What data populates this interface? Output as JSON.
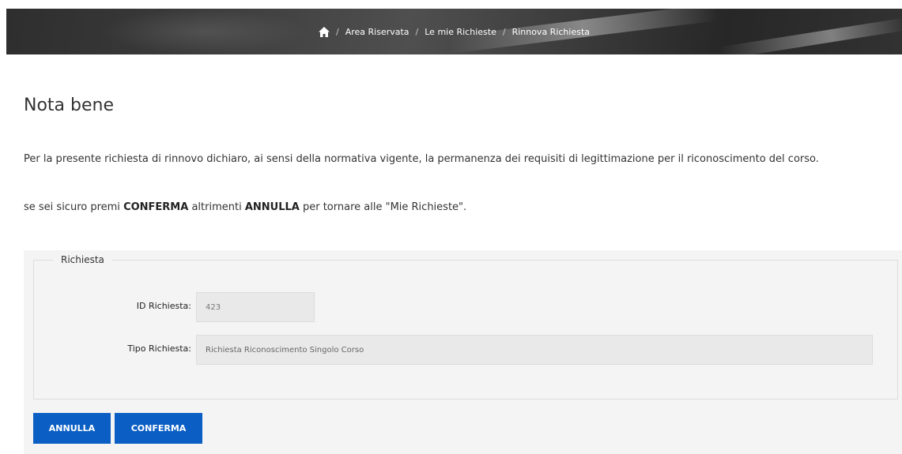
{
  "breadcrumb": {
    "home_icon": "home-icon",
    "separator": "/",
    "items": [
      "Area Riservata",
      "Le mie Richieste",
      "Rinnova Richiesta"
    ]
  },
  "page": {
    "title": "Nota bene",
    "notice_text": "Per la presente richiesta di rinnovo dichiaro, ai sensi della normativa vigente, la permanenza dei requisiti di legittimazione per il riconoscimento del corso.",
    "confirm_prefix": "se sei sicuro premi ",
    "confirm_keyword": "CONFERMA",
    "confirm_middle": " altrimenti ",
    "cancel_keyword": "ANNULLA",
    "confirm_suffix": " per tornare alle \"Mie Richieste\"."
  },
  "form": {
    "legend": "Richiesta",
    "id_label": "ID Richiesta:",
    "id_value": "423",
    "tipo_label": "Tipo Richiesta:",
    "tipo_value": "Richiesta Riconoscimento Singolo Corso"
  },
  "actions": {
    "cancel_label": "ANNULLA",
    "confirm_label": "CONFERMA"
  },
  "colors": {
    "primary_button": "#0b5fc4",
    "panel_background": "#f4f4f4",
    "banner_background": "#3a3a3a"
  }
}
